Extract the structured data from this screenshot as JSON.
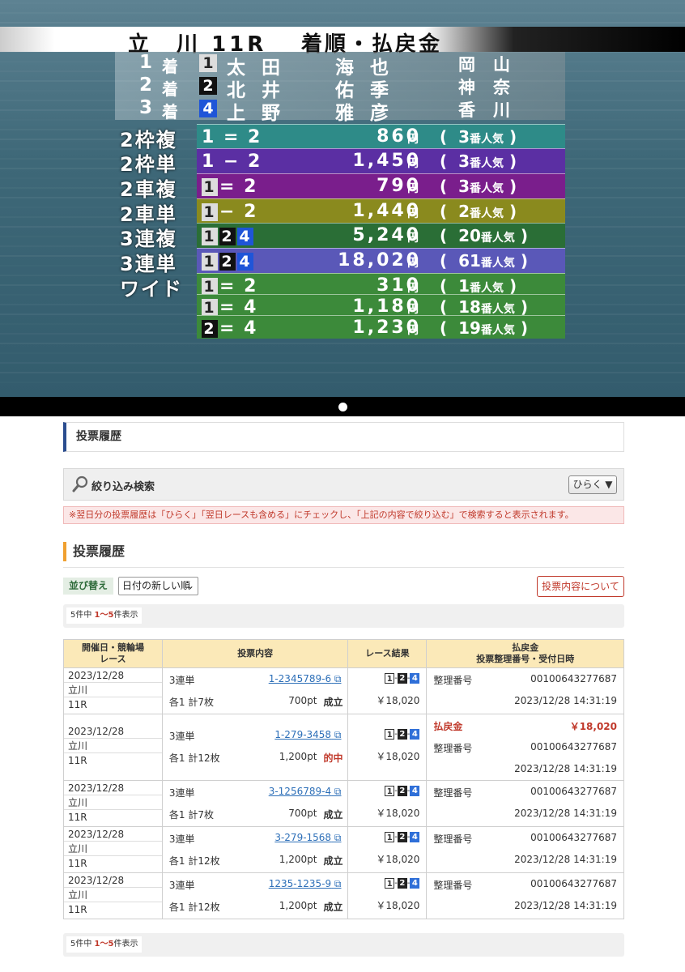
{
  "broadcast": {
    "title_venue": "立　川",
    "title_race": "11R",
    "title_caption": "着順・払戻金",
    "finishers": [
      {
        "rank": "1",
        "suffix": "着",
        "frame": "1",
        "surname": "太田",
        "given": "海也",
        "pref": "岡山"
      },
      {
        "rank": "2",
        "suffix": "着",
        "frame": "2",
        "surname": "北井",
        "given": "佑季",
        "pref": "神奈"
      },
      {
        "rank": "3",
        "suffix": "着",
        "frame": "4",
        "surname": "上野",
        "given": "雅彦",
        "pref": "香川"
      }
    ],
    "payouts": [
      {
        "type": "2枠複",
        "combo_plain": "1 = 2",
        "boxed": false,
        "amount": "860",
        "yen": "円",
        "pop_open": "(",
        "pop_num": "3",
        "pop_label": "番人気",
        "pop_close": ")",
        "color": "#2e8b88"
      },
      {
        "type": "2枠単",
        "combo_plain": "1 − 2",
        "boxed": false,
        "amount": "1,450",
        "yen": "円",
        "pop_open": "(",
        "pop_num": "3",
        "pop_label": "番人気",
        "pop_close": ")",
        "color": "#5b2fa3"
      },
      {
        "type": "2車複",
        "combo_boxes": [
          "1"
        ],
        "combo_tail": "= 2",
        "boxed": true,
        "amount": "790",
        "yen": "円",
        "pop_open": "(",
        "pop_num": "3",
        "pop_label": "番人気",
        "pop_close": ")",
        "color": "#7a1e8c"
      },
      {
        "type": "2車単",
        "combo_boxes": [
          "1"
        ],
        "combo_tail": "− 2",
        "boxed": true,
        "amount": "1,440",
        "yen": "円",
        "pop_open": "(",
        "pop_num": "2",
        "pop_label": "番人気",
        "pop_close": ")",
        "color": "#8a8a1e"
      },
      {
        "type": "3連複",
        "combo_boxes": [
          "1",
          "2",
          "4"
        ],
        "combo_tail": "",
        "boxed": true,
        "amount": "5,240",
        "yen": "円",
        "pop_open": "(",
        "pop_num": "20",
        "pop_label": "番人気",
        "pop_close": ")",
        "color": "#2a6e36"
      },
      {
        "type": "3連単",
        "combo_boxes": [
          "1",
          "2",
          "4"
        ],
        "combo_tail": "",
        "boxed": true,
        "amount": "18,020",
        "yen": "円",
        "pop_open": "(",
        "pop_num": "61",
        "pop_label": "番人気",
        "pop_close": ")",
        "color": "#5a58b8"
      },
      {
        "type": "ワイド",
        "combo_boxes": [
          "1"
        ],
        "combo_tail": "= 2",
        "boxed": true,
        "amount": "310",
        "yen": "円",
        "pop_open": "(",
        "pop_num": "1",
        "pop_label": "番人気",
        "pop_close": ")",
        "color": "#3c8a3a"
      },
      {
        "type": "",
        "combo_boxes": [
          "1"
        ],
        "combo_tail": "= 4",
        "boxed": true,
        "amount": "1,180",
        "yen": "円",
        "pop_open": "(",
        "pop_num": "18",
        "pop_label": "番人気",
        "pop_close": ")",
        "color": "#3c8a3a"
      },
      {
        "type": "",
        "combo_boxes": [
          "2"
        ],
        "combo_tail": "= 4",
        "boxed": true,
        "amount": "1,230",
        "yen": "円",
        "pop_open": "(",
        "pop_num": "19",
        "pop_label": "番人気",
        "pop_close": ")",
        "color": "#3c8a3a"
      }
    ]
  },
  "page": {
    "panel_title": "投票履歴",
    "filter_label": "絞り込み検索",
    "filter_open_button": "ひらく",
    "notice": "※翌日分の投票履歴は「ひらく」「翌日レースも含める」にチェックし、「上記の内容で絞り込む」で検索すると表示されます。",
    "history_title": "投票履歴",
    "sort_label": "並び替え",
    "sort_selected": "日付の新しい順",
    "about_button": "投票内容について",
    "count_prefix": "5件中 ",
    "count_range": "1〜5",
    "count_suffix": "件表示"
  },
  "table": {
    "headers": {
      "col1_line1": "開催日・競輪場",
      "col1_line2": "レース",
      "col2": "投票内容",
      "col3": "レース結果",
      "col4_line1": "払戻金",
      "col4_line2": "投票整理番号・受付日時"
    },
    "rows": [
      {
        "date": "2023/12/28",
        "venue": "立川",
        "race": "11R",
        "bet_type": "3連単",
        "ticket": "1-2345789-6",
        "units": "各1 計7枚",
        "points": "700pt",
        "status": "成立",
        "hit": false,
        "result": [
          "1",
          "2",
          "4"
        ],
        "result_amount": "￥18,020",
        "payout_label": "",
        "payout_amount": "",
        "ref_label": "整理番号",
        "ref_no": "00100643277687",
        "datetime": "2023/12/28 14:31:19"
      },
      {
        "date": "2023/12/28",
        "venue": "立川",
        "race": "11R",
        "bet_type": "3連単",
        "ticket": "1-279-3458",
        "units": "各1 計12枚",
        "points": "1,200pt",
        "status": "的中",
        "hit": true,
        "result": [
          "1",
          "2",
          "4"
        ],
        "result_amount": "￥18,020",
        "payout_label": "払戻金",
        "payout_amount": "￥18,020",
        "ref_label": "整理番号",
        "ref_no": "00100643277687",
        "datetime": "2023/12/28 14:31:19"
      },
      {
        "date": "2023/12/28",
        "venue": "立川",
        "race": "11R",
        "bet_type": "3連単",
        "ticket": "3-1256789-4",
        "units": "各1 計7枚",
        "points": "700pt",
        "status": "成立",
        "hit": false,
        "result": [
          "1",
          "2",
          "4"
        ],
        "result_amount": "￥18,020",
        "payout_label": "",
        "payout_amount": "",
        "ref_label": "整理番号",
        "ref_no": "00100643277687",
        "datetime": "2023/12/28 14:31:19"
      },
      {
        "date": "2023/12/28",
        "venue": "立川",
        "race": "11R",
        "bet_type": "3連単",
        "ticket": "3-279-1568",
        "units": "各1 計12枚",
        "points": "1,200pt",
        "status": "成立",
        "hit": false,
        "result": [
          "1",
          "2",
          "4"
        ],
        "result_amount": "￥18,020",
        "payout_label": "",
        "payout_amount": "",
        "ref_label": "整理番号",
        "ref_no": "00100643277687",
        "datetime": "2023/12/28 14:31:19"
      },
      {
        "date": "2023/12/28",
        "venue": "立川",
        "race": "11R",
        "bet_type": "3連単",
        "ticket": "1235-1235-9",
        "units": "各1 計12枚",
        "points": "1,200pt",
        "status": "成立",
        "hit": false,
        "result": [
          "1",
          "2",
          "4"
        ],
        "result_amount": "￥18,020",
        "payout_label": "",
        "payout_amount": "",
        "ref_label": "整理番号",
        "ref_no": "00100643277687",
        "datetime": "2023/12/28 14:31:19"
      }
    ]
  },
  "icons": {
    "filter": "search-icon",
    "dropdown": "triangle-down-icon",
    "external_link": "external-link-icon"
  },
  "colors": {
    "accent_blue": "#2b4d8f",
    "accent_orange": "#f0a030",
    "alert_red": "#c0392b",
    "table_header": "#fbe9b8"
  }
}
